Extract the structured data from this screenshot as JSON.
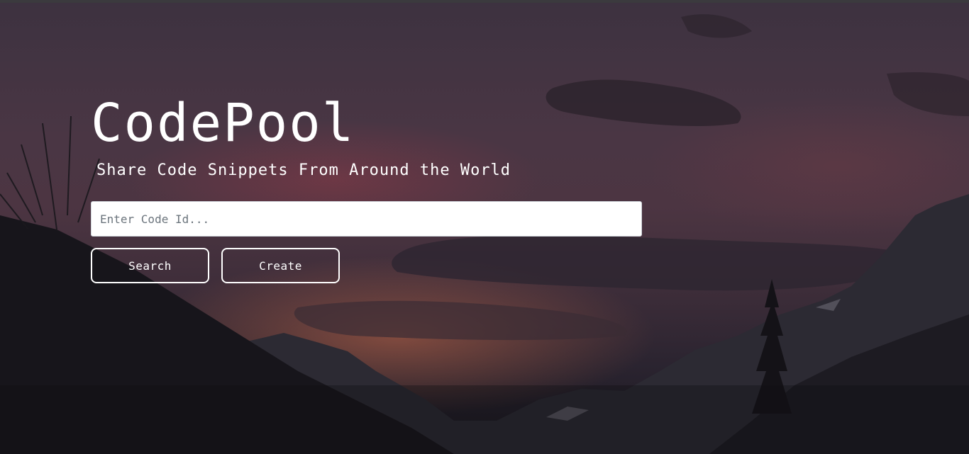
{
  "hero": {
    "title": "CodePool",
    "subtitle": "Share Code Snippets From Around the World"
  },
  "search": {
    "placeholder": "Enter Code Id...",
    "value": ""
  },
  "actions": {
    "search_label": "Search",
    "create_label": "Create"
  },
  "background": {
    "description_icon": "mountain-sunset-background",
    "colors": {
      "sky_top": "#3d3240",
      "sunset_glow": "#c46848",
      "mountains": "#1a1820"
    }
  }
}
